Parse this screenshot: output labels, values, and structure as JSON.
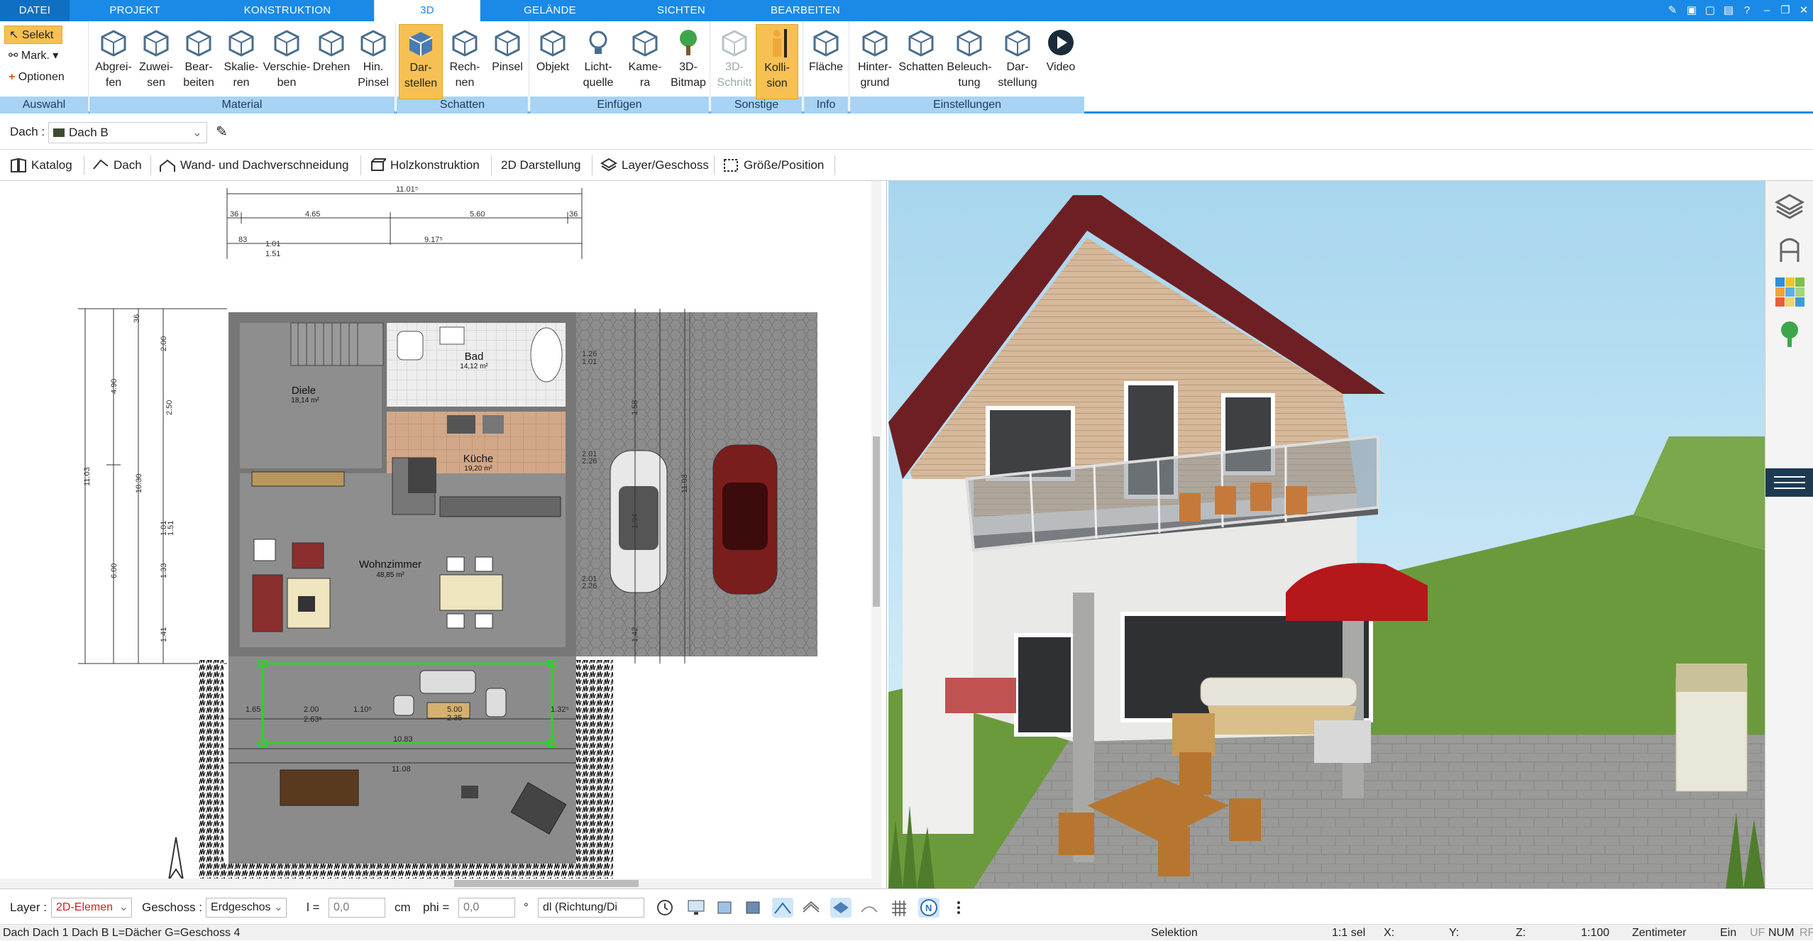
{
  "menu": {
    "tabs": [
      "DATEI",
      "PROJEKT",
      "KONSTRUKTION",
      "3D",
      "GELÄNDE",
      "SICHTEN",
      "BEARBEITEN"
    ]
  },
  "ribbon": {
    "auswahl": {
      "selekt": "Selekt",
      "mark": "Mark.",
      "optionen": "Optionen",
      "group": "Auswahl"
    },
    "material": {
      "group": "Material",
      "buttons": [
        [
          "Abgrei-",
          "fen"
        ],
        [
          "Zuwei-",
          "sen"
        ],
        [
          "Bear-",
          "beiten"
        ],
        [
          "Skalie-",
          "ren"
        ],
        [
          "Verschie-",
          "ben"
        ],
        [
          "Drehen",
          ""
        ],
        [
          "Hin.",
          "Pinsel"
        ]
      ]
    },
    "schatten": {
      "group": "Schatten",
      "buttons": [
        [
          "Dar-",
          "stellen"
        ],
        [
          "Rech-",
          "nen"
        ],
        [
          "Pinsel",
          ""
        ]
      ]
    },
    "einfuegen": {
      "group": "Einfügen",
      "buttons": [
        [
          "Objekt",
          ""
        ],
        [
          "Licht-",
          "quelle"
        ],
        [
          "Kame-",
          "ra"
        ],
        [
          "3D-",
          "Bitmap"
        ]
      ]
    },
    "sonstige": {
      "group": "Sonstige",
      "buttons": [
        [
          "3D-",
          "Schnitt"
        ],
        [
          "Kolli-",
          "sion"
        ]
      ]
    },
    "info": {
      "group": "Info",
      "buttons": [
        [
          "Fläche",
          ""
        ]
      ]
    },
    "einstellungen": {
      "group": "Einstellungen",
      "buttons": [
        [
          "Hinter-",
          "grund"
        ],
        [
          "Schatten",
          ""
        ],
        [
          "Beleuch-",
          "tung"
        ],
        [
          "Dar-",
          "stellung"
        ],
        [
          "Video",
          ""
        ]
      ]
    }
  },
  "selection": {
    "label": "Dach :",
    "value": "Dach B"
  },
  "subtoolbar": [
    "Katalog",
    "Dach",
    "Wand- und Dachverschneidung",
    "Holzkonstruktion",
    "2D Darstellung",
    "Layer/Geschoss",
    "Größe/Position"
  ],
  "plan": {
    "rooms": [
      {
        "name": "Bad",
        "area": "14,12 m²"
      },
      {
        "name": "Diele",
        "area": "18,14 m²"
      },
      {
        "name": "Küche",
        "area": "19,20 m²"
      },
      {
        "name": "Wohnzimmer",
        "area": "48,85 m²"
      }
    ],
    "dims_top": [
      "11.01⁵",
      "4.65",
      "5.60",
      "9.17⁵",
      "36",
      "36",
      "83",
      "1.01",
      "1.51"
    ],
    "dims_left": [
      "11.03",
      "4.90",
      "10.30",
      "6.00",
      "2.00",
      "2.50",
      "1.01",
      "1.51",
      "1.33",
      "1.41",
      "36"
    ],
    "dims_right": [
      "11.03",
      "1.26",
      "1.01",
      "1.58",
      "2.01",
      "2.26",
      "2.01",
      "2.26",
      "1.94",
      "1.42"
    ],
    "dims_terrace": [
      "2.00",
      "2.63⁵",
      "1.10⁵",
      "5.00",
      "2.35",
      "11.08",
      "1.65",
      "1.32⁵",
      "10.83"
    ]
  },
  "bottom": {
    "layer_label": "Layer :",
    "layer_value": "2D-Elemen",
    "geschoss_label": "Geschoss :",
    "geschoss_value": "Erdgeschos",
    "l_label": "l =",
    "l_value": "0,0",
    "l_unit": "cm",
    "phi_label": "phi =",
    "phi_value": "0,0",
    "phi_unit": "°",
    "dir_value": "dl (Richtung/Di"
  },
  "status": {
    "left": "Dach Dach 1 Dach B L=Dächer G=Geschoss 4",
    "mode": "Selektion",
    "sel": "1:1 sel",
    "x": "X:",
    "y": "Y:",
    "z": "Z:",
    "scale": "1:100",
    "unit": "Zentimeter",
    "ein": "Ein",
    "uf": "UF",
    "num": "NUM",
    "rf": "RF"
  },
  "colors": {
    "accent": "#1a8ae6",
    "ribbon_group": "#a8d3f5",
    "selected": "#f6c053"
  }
}
